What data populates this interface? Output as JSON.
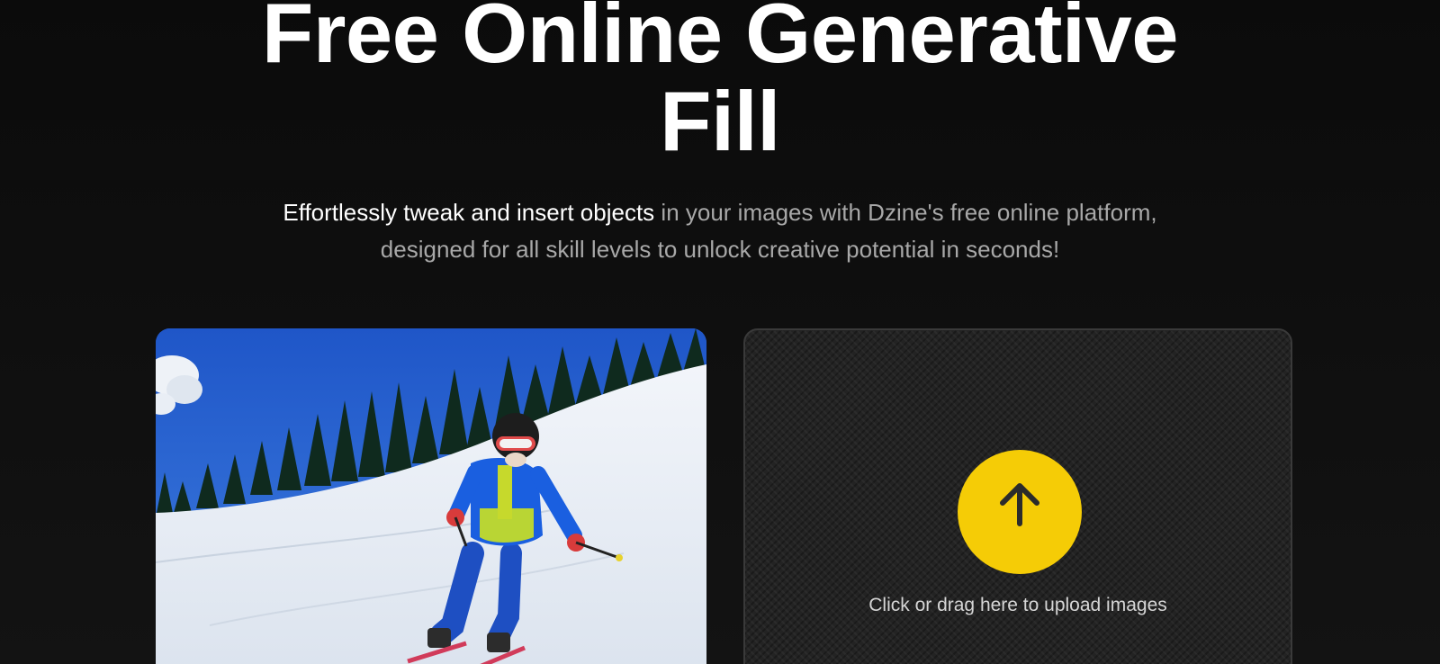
{
  "hero": {
    "title_line1": "Free Online Generative",
    "title_line2": "Fill",
    "subtitle_emphasis": "Effortlessly tweak and insert objects",
    "subtitle_rest": " in your images with Dzine's free online platform,",
    "subtitle_line2": "designed for all skill levels to unlock creative potential in seconds!"
  },
  "upload": {
    "label": "Click or drag here to upload images",
    "icon": "arrow-up-icon",
    "accent_color": "#f5cc06"
  },
  "preview": {
    "icon": "skier-photo"
  }
}
